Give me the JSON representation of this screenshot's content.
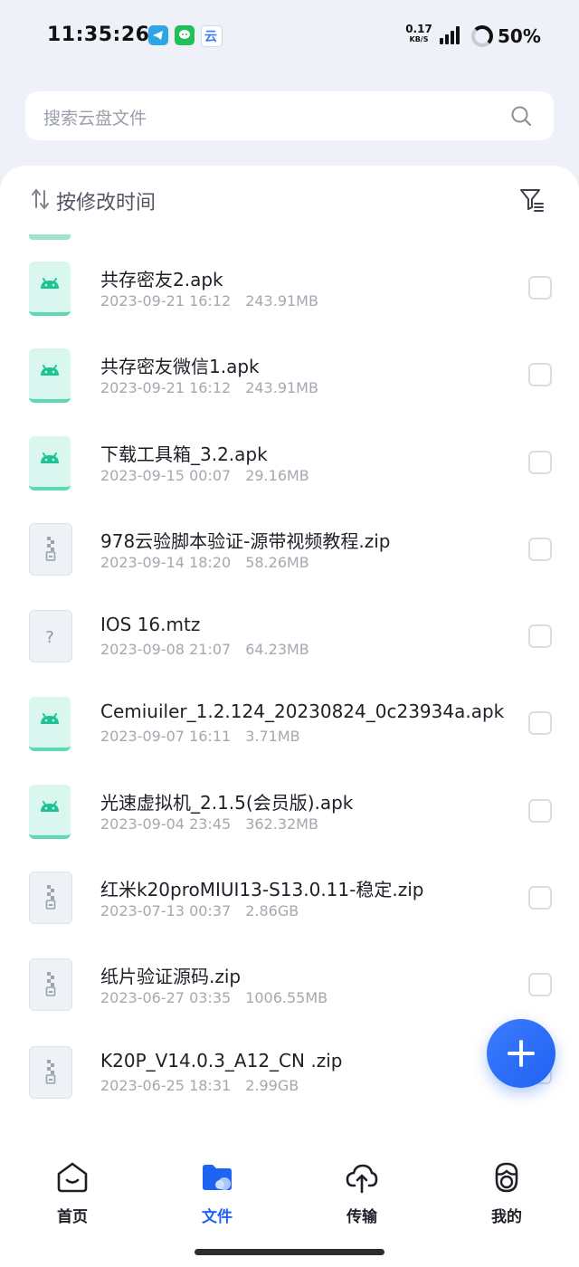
{
  "status_bar": {
    "time": "11:35:26",
    "net_speed_value": "0.17",
    "net_speed_unit": "KB/S",
    "battery": "50%",
    "notification_icons": [
      "telegram-icon",
      "wechat-icon",
      "cloud-app-icon"
    ],
    "cloud_app_glyph": "云"
  },
  "search": {
    "placeholder": "搜索云盘文件"
  },
  "sort": {
    "label": "按修改时间"
  },
  "files": [
    {
      "name": "共存密友2.apk",
      "date": "2023-09-21 16:12",
      "size": "243.91MB",
      "type": "apk"
    },
    {
      "name": "共存密友微信1.apk",
      "date": "2023-09-21 16:12",
      "size": "243.91MB",
      "type": "apk"
    },
    {
      "name": "下载工具箱_3.2.apk",
      "date": "2023-09-15 00:07",
      "size": "29.16MB",
      "type": "apk"
    },
    {
      "name": "978云验脚本验证-源带视频教程.zip",
      "date": "2023-09-14 18:20",
      "size": "58.26MB",
      "type": "zip"
    },
    {
      "name": "IOS 16.mtz",
      "date": "2023-09-08 21:07",
      "size": "64.23MB",
      "type": "unknown"
    },
    {
      "name": "Cemiuiler_1.2.124_20230824_0c23934a.apk",
      "date": "2023-09-07 16:11",
      "size": "3.71MB",
      "type": "apk"
    },
    {
      "name": "光速虚拟机_2.1.5(会员版).apk",
      "date": "2023-09-04 23:45",
      "size": "362.32MB",
      "type": "apk"
    },
    {
      "name": "红米k20proMIUI13-S13.0.11-稳定.zip",
      "date": "2023-07-13 00:37",
      "size": "2.86GB",
      "type": "zip"
    },
    {
      "name": "纸片验证源码.zip",
      "date": "2023-06-27 03:35",
      "size": "1006.55MB",
      "type": "zip"
    },
    {
      "name": "K20P_V14.0.3_A12_CN .zip",
      "date": "2023-06-25 18:31",
      "size": "2.99GB",
      "type": "zip"
    }
  ],
  "nav": {
    "items": [
      {
        "label": "首页",
        "icon": "home-icon",
        "active": false
      },
      {
        "label": "文件",
        "icon": "folder-icon",
        "active": true
      },
      {
        "label": "传输",
        "icon": "cloud-transfer-icon",
        "active": false
      },
      {
        "label": "我的",
        "icon": "profile-icon",
        "active": false
      }
    ]
  },
  "colors": {
    "accent": "#1e63f2",
    "apk_icon_bg": "#d9f7ee",
    "apk_icon_fg": "#1fc293",
    "background": "#eef1f8"
  }
}
